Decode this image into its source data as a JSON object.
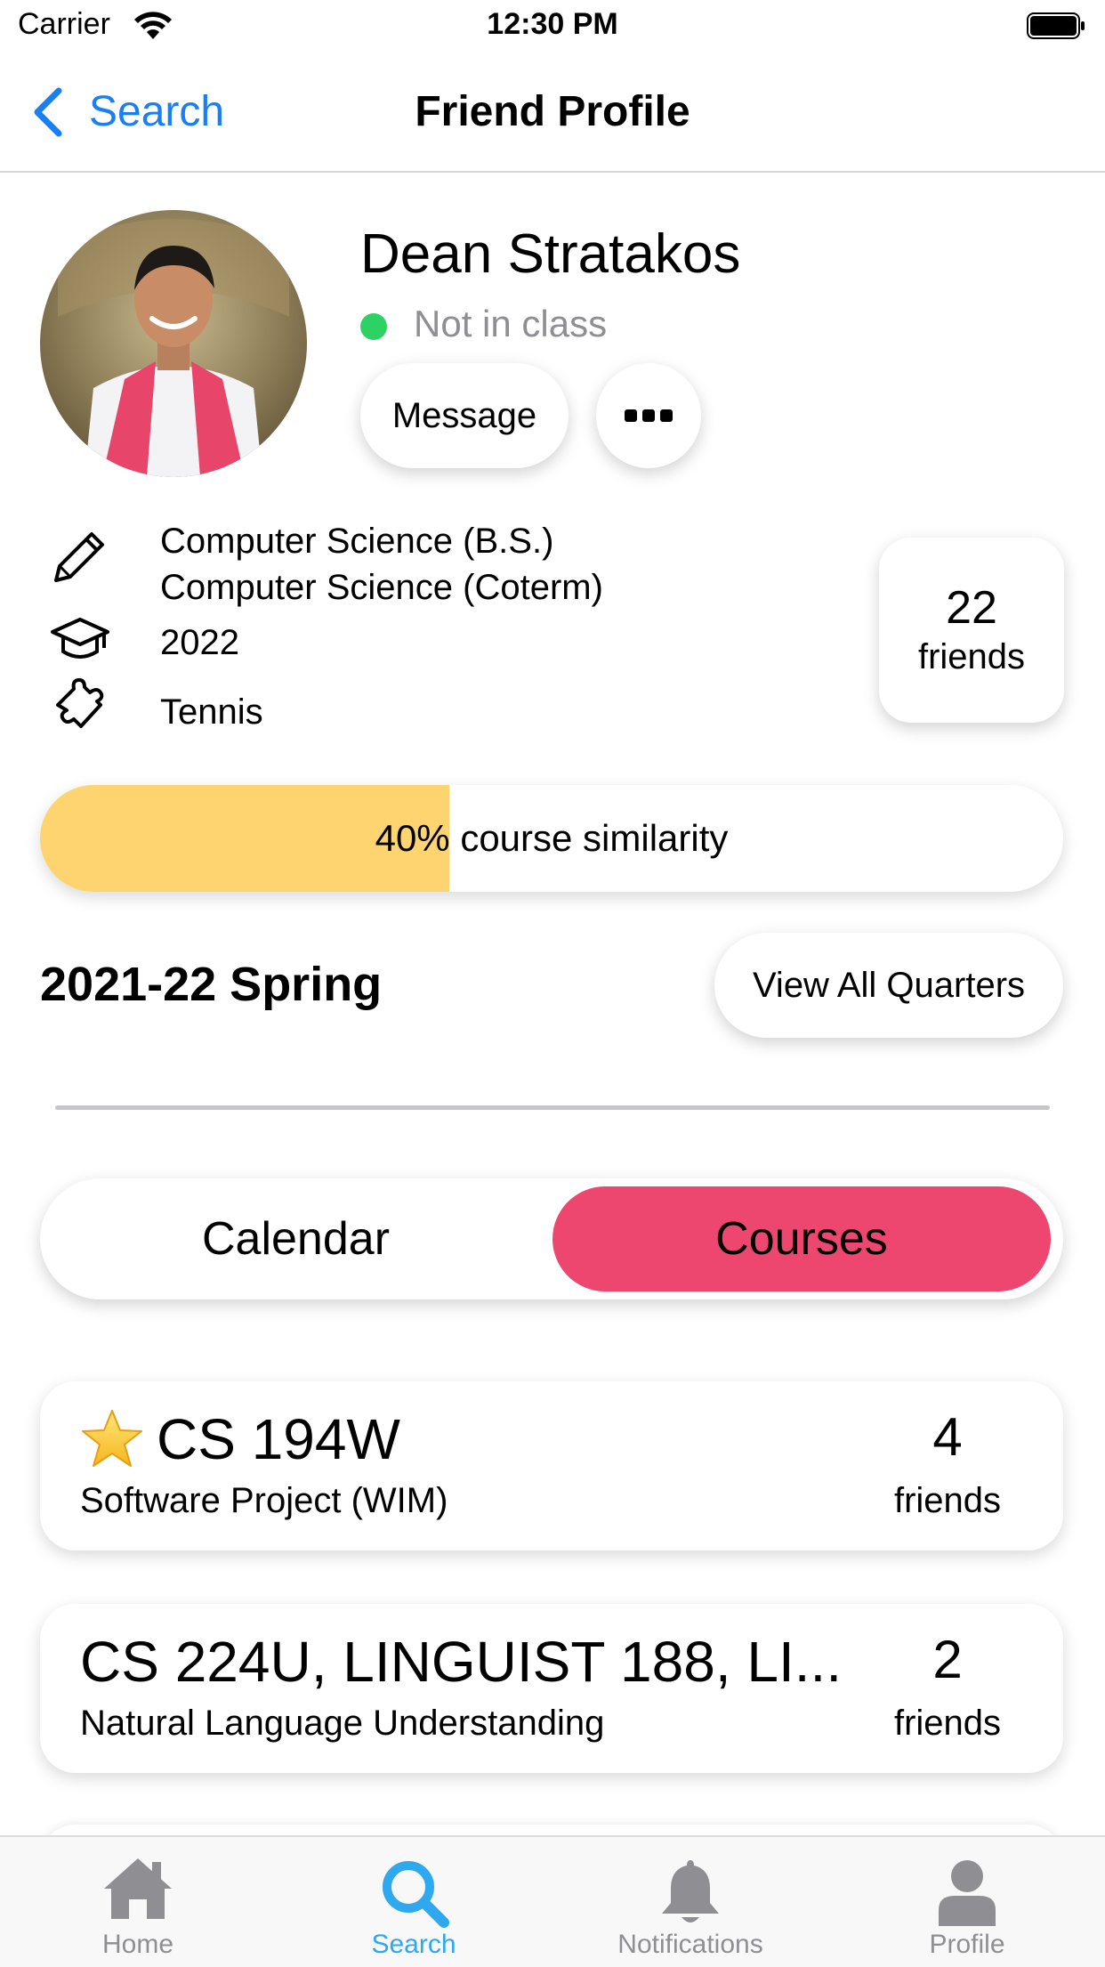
{
  "status_bar": {
    "carrier": "Carrier",
    "time": "12:30 PM"
  },
  "nav": {
    "back_label": "Search",
    "title": "Friend Profile"
  },
  "profile": {
    "name": "Dean Stratakos",
    "status": "Not in class",
    "message_label": "Message",
    "majors": [
      "Computer Science (B.S.)",
      "Computer Science (Coterm)"
    ],
    "year": "2022",
    "activity": "Tennis",
    "friends_count": "22",
    "friends_label": "friends"
  },
  "similarity": {
    "percent_text": "40%",
    "label": "course similarity",
    "fraction": 0.4
  },
  "quarter": {
    "title": "2021-22 Spring",
    "view_all_label": "View All Quarters"
  },
  "segments": {
    "calendar": "Calendar",
    "courses": "Courses",
    "active": "Courses"
  },
  "courses": [
    {
      "code": "CS 194W",
      "name": "Software Project (WIM)",
      "friends": "4",
      "friends_label": "friends",
      "starred": true
    },
    {
      "code": "CS 224U, LINGUIST 188, LI...",
      "name": "Natural Language Understanding",
      "friends": "2",
      "friends_label": "friends",
      "starred": false
    }
  ],
  "tabs": [
    {
      "label": "Home",
      "icon": "home-icon"
    },
    {
      "label": "Search",
      "icon": "search-icon"
    },
    {
      "label": "Notifications",
      "icon": "bell-icon"
    },
    {
      "label": "Profile",
      "icon": "person-icon"
    }
  ],
  "colors": {
    "accent": "#1a7ff0",
    "status_online": "#2ed164",
    "similarity_fill": "#fdd46f",
    "segment_active": "#ee476f",
    "tab_active": "#2ea8ee",
    "tab_inactive": "#8e8e93"
  }
}
